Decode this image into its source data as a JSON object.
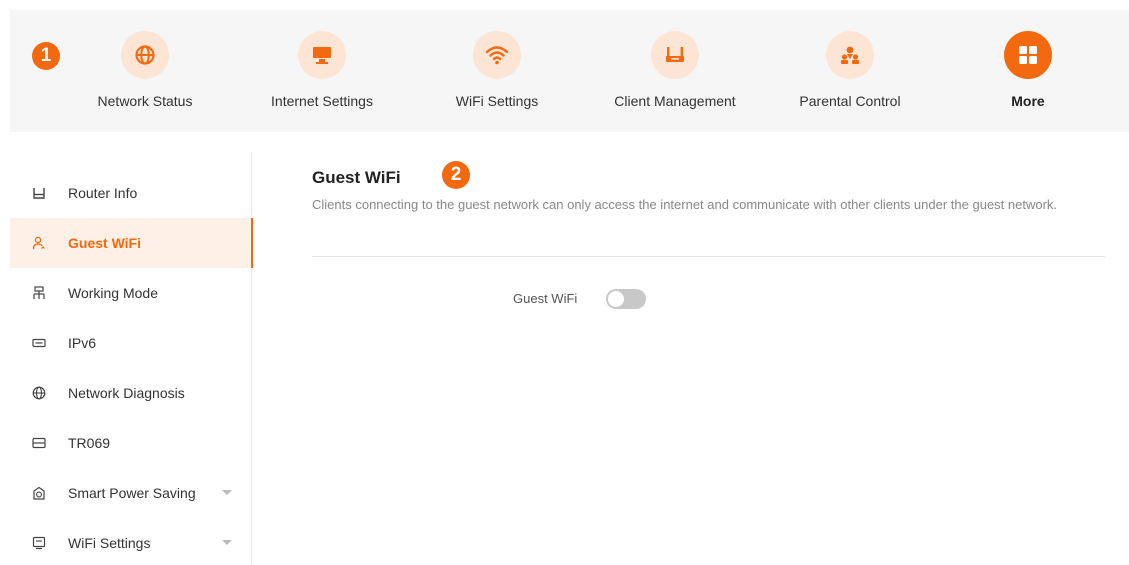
{
  "callouts": [
    "1",
    "2"
  ],
  "nav": {
    "items": [
      {
        "label": "Network Status",
        "icon": "globe-icon"
      },
      {
        "label": "Internet Settings",
        "icon": "monitor-icon"
      },
      {
        "label": "WiFi Settings",
        "icon": "wifi-icon"
      },
      {
        "label": "Client Management",
        "icon": "router-icon"
      },
      {
        "label": "Parental Control",
        "icon": "family-icon"
      },
      {
        "label": "More",
        "icon": "grid-icon",
        "active": true
      }
    ]
  },
  "sidebar": {
    "items": [
      {
        "label": "Router Info",
        "icon": "router-info-icon"
      },
      {
        "label": "Guest WiFi",
        "icon": "guest-icon",
        "active": true
      },
      {
        "label": "Working Mode",
        "icon": "network-tree-icon"
      },
      {
        "label": "IPv6",
        "icon": "ipv6-icon"
      },
      {
        "label": "Network Diagnosis",
        "icon": "globe-icon"
      },
      {
        "label": "TR069",
        "icon": "card-icon"
      },
      {
        "label": "Smart Power Saving",
        "icon": "alarm-icon",
        "expandable": true
      },
      {
        "label": "WiFi Settings",
        "icon": "screen-icon",
        "expandable": true
      }
    ]
  },
  "main": {
    "title": "Guest WiFi",
    "description": "Clients connecting to the guest network can only access the internet and communicate with other clients under the guest network.",
    "toggle_label": "Guest WiFi",
    "toggle_on": false
  },
  "colors": {
    "accent": "#f2690f",
    "accent_light": "#fde5d6",
    "nav_bg": "#f6f6f6",
    "sidebar_active_bg": "#fdf0e6"
  }
}
